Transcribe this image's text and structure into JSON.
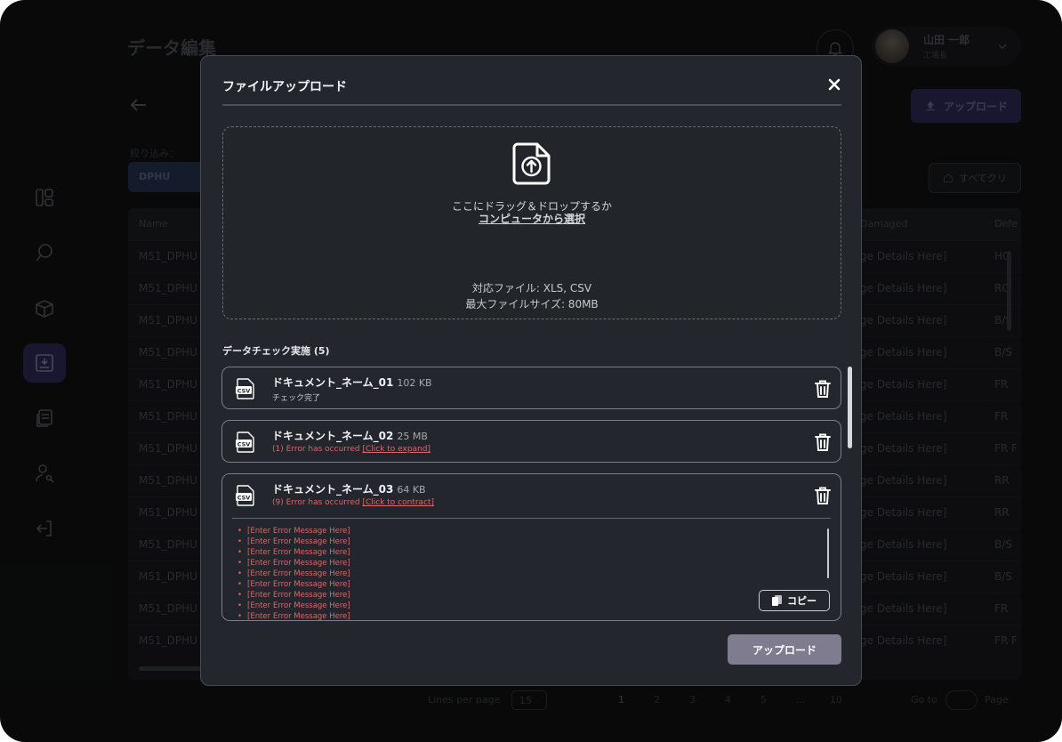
{
  "app": {
    "page_title": "データ編集",
    "user": {
      "name": "山田 一郎",
      "role": "工場長"
    },
    "upload_button_label": "アップロード",
    "filter": {
      "label": "絞り込み：",
      "chip": "DPHU"
    },
    "clear_button_label": "すべてクリ",
    "table": {
      "headers": {
        "name": "Name",
        "damaged": "Damaged",
        "defect": "Defe"
      },
      "rows": [
        {
          "name": "M51_DPHU",
          "damaged": "ge Details Here]",
          "defect": "HO"
        },
        {
          "name": "M51_DPHU",
          "damaged": "ge Details Here]",
          "defect": "RO"
        },
        {
          "name": "M51_DPHU",
          "damaged": "ge Details Here]",
          "defect": "B/S"
        },
        {
          "name": "M51_DPHU",
          "damaged": "ge Details Here]",
          "defect": "B/S"
        },
        {
          "name": "M51_DPHU",
          "damaged": "ge Details Here]",
          "defect": "FR"
        },
        {
          "name": "M51_DPHU",
          "damaged": "ge Details Here]",
          "defect": "FR"
        },
        {
          "name": "M51_DPHU",
          "damaged": "ge Details Here]",
          "defect": "FR F"
        },
        {
          "name": "M51_DPHU",
          "damaged": "ge Details Here]",
          "defect": "RR"
        },
        {
          "name": "M51_DPHU",
          "damaged": "ge Details Here]",
          "defect": "RR"
        },
        {
          "name": "M51_DPHU",
          "damaged": "ge Details Here]",
          "defect": "B/S"
        },
        {
          "name": "M51_DPHU",
          "damaged": "ge Details Here]",
          "defect": "B/S"
        },
        {
          "name": "M51_DPHU",
          "damaged": "ge Details Here]",
          "defect": "FR"
        },
        {
          "name": "M51_DPHU",
          "damaged": "ge Details Here]",
          "defect": "FR F"
        }
      ]
    },
    "pager": {
      "lines_label": "Lines per page",
      "lines_value": "15",
      "pages": [
        "1",
        "2",
        "3",
        "4",
        "5",
        "...",
        "10"
      ],
      "goto_label": "Go to",
      "page_label": "Page"
    }
  },
  "modal": {
    "title": "ファイルアップロード",
    "dropzone": {
      "instruction": "ここにドラッグ＆ドロップするか",
      "select_link": "コンピュータから選択",
      "formats": "対応ファイル: XLS, CSV",
      "max_size": "最大ファイルサイズ: 80MB"
    },
    "section_title": "データチェック実施 (5)",
    "files": [
      {
        "icon_text": "CSV",
        "name": "ドキュメント_ネーム_01",
        "size": "102 KB",
        "status": "チェック完了"
      },
      {
        "icon_text": "CSV",
        "name": "ドキュメント_ネーム_02",
        "size": "25 MB",
        "error_count": "(1) Error has occurred",
        "toggle": "[Click to expand]"
      },
      {
        "icon_text": "CSV",
        "name": "ドキュメント_ネーム_03",
        "size": "64 KB",
        "error_count": "(9) Error has occurred",
        "toggle": "[Click to contract]",
        "errors": [
          "[Enter Error Message Here]",
          "[Enter Error Message Here]",
          "[Enter Error Message Here]",
          "[Enter Error Message Here]",
          "[Enter Error Message Here]",
          "[Enter Error Message Here]",
          "[Enter Error Message Here]",
          "[Enter Error Message Here]",
          "[Enter Error Message Here]"
        ],
        "copy_label": "コピー"
      }
    ],
    "upload_label": "アップロード"
  },
  "colors": {
    "modal_bg": "#23262c",
    "error": "#d46a6a",
    "primary_disabled": "#7f7c8f",
    "accent_dim": "#27244a"
  }
}
